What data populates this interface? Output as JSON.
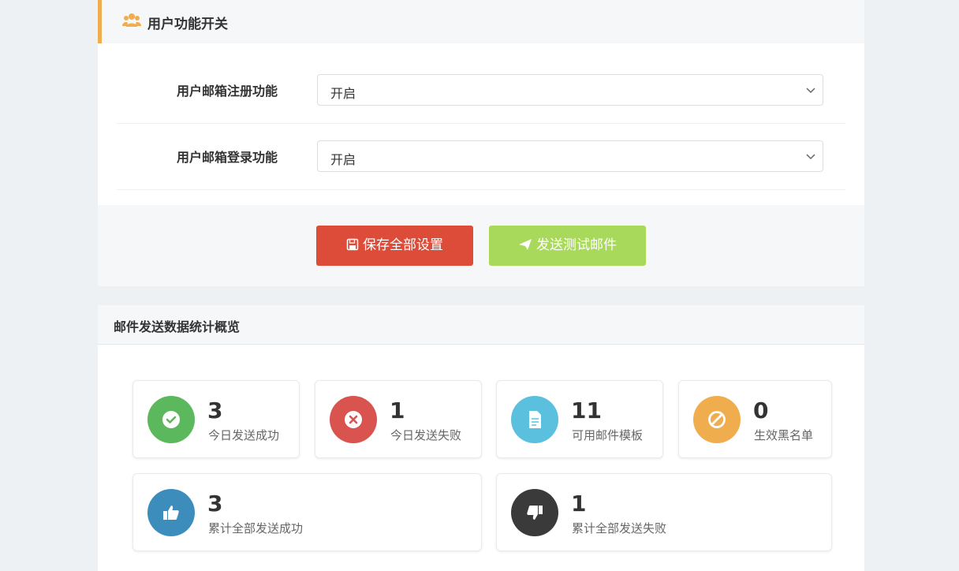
{
  "user_section": {
    "title": "用户功能开关",
    "rows": [
      {
        "label": "用户邮箱注册功能",
        "value": "开启"
      },
      {
        "label": "用户邮箱登录功能",
        "value": "开启"
      }
    ]
  },
  "actions": {
    "save_label": "保存全部设置",
    "test_label": "发送测试邮件"
  },
  "stats_section": {
    "title": "邮件发送数据统计概览",
    "items": [
      {
        "value": "3",
        "label": "今日发送成功",
        "icon": "check-icon",
        "color": "#5cb85c"
      },
      {
        "value": "1",
        "label": "今日发送失败",
        "icon": "x-circle-icon",
        "color": "#d9534f"
      },
      {
        "value": "11",
        "label": "可用邮件模板",
        "icon": "document-icon",
        "color": "#5bc0de"
      },
      {
        "value": "0",
        "label": "生效黑名单",
        "icon": "ban-icon",
        "color": "#f0ad4e"
      },
      {
        "value": "3",
        "label": "累计全部发送成功",
        "icon": "thumbs-up-icon",
        "color": "#3c8dbc"
      },
      {
        "value": "1",
        "label": "累计全部发送失败",
        "icon": "thumbs-down-icon",
        "color": "#3a3a3a"
      }
    ]
  },
  "colors": {
    "accent": "#f0ad4e",
    "save_button": "#dd4b39",
    "test_button": "#a8d95b"
  }
}
